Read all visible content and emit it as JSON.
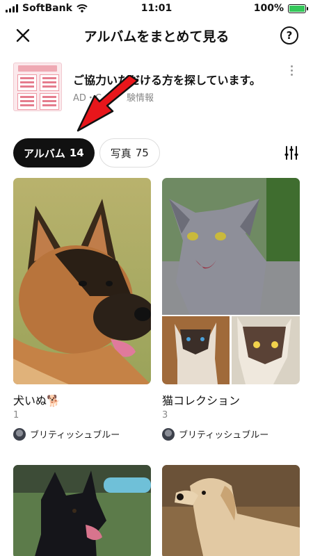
{
  "status_bar": {
    "carrier": "SoftBank",
    "time": "11:01",
    "battery": "100%",
    "battery_level": 1.0
  },
  "header": {
    "title": "アルバムをまとめて見る",
    "help_label": "?"
  },
  "ad": {
    "title": "ご協力いただける方を探しています。",
    "sublabel": "AD・C",
    "sublabel_tail": "験情報"
  },
  "tabs": [
    {
      "label": "アルバム",
      "count": "14",
      "active": true
    },
    {
      "label": "写真",
      "count": "75",
      "active": false
    }
  ],
  "albums": [
    {
      "title": "犬いぬ🐕",
      "count": "1",
      "owner": "ブリティッシュブルー"
    },
    {
      "title": "猫コレクション",
      "count": "3",
      "owner": "ブリティッシュブルー"
    }
  ],
  "colors": {
    "accent": "#111111",
    "arrow": "#e8161b",
    "battery": "#34c759",
    "muted": "#888888"
  },
  "icons": {
    "close": "close-icon",
    "help": "help-icon",
    "filter": "sliders-icon",
    "more": "more-vertical-icon"
  }
}
